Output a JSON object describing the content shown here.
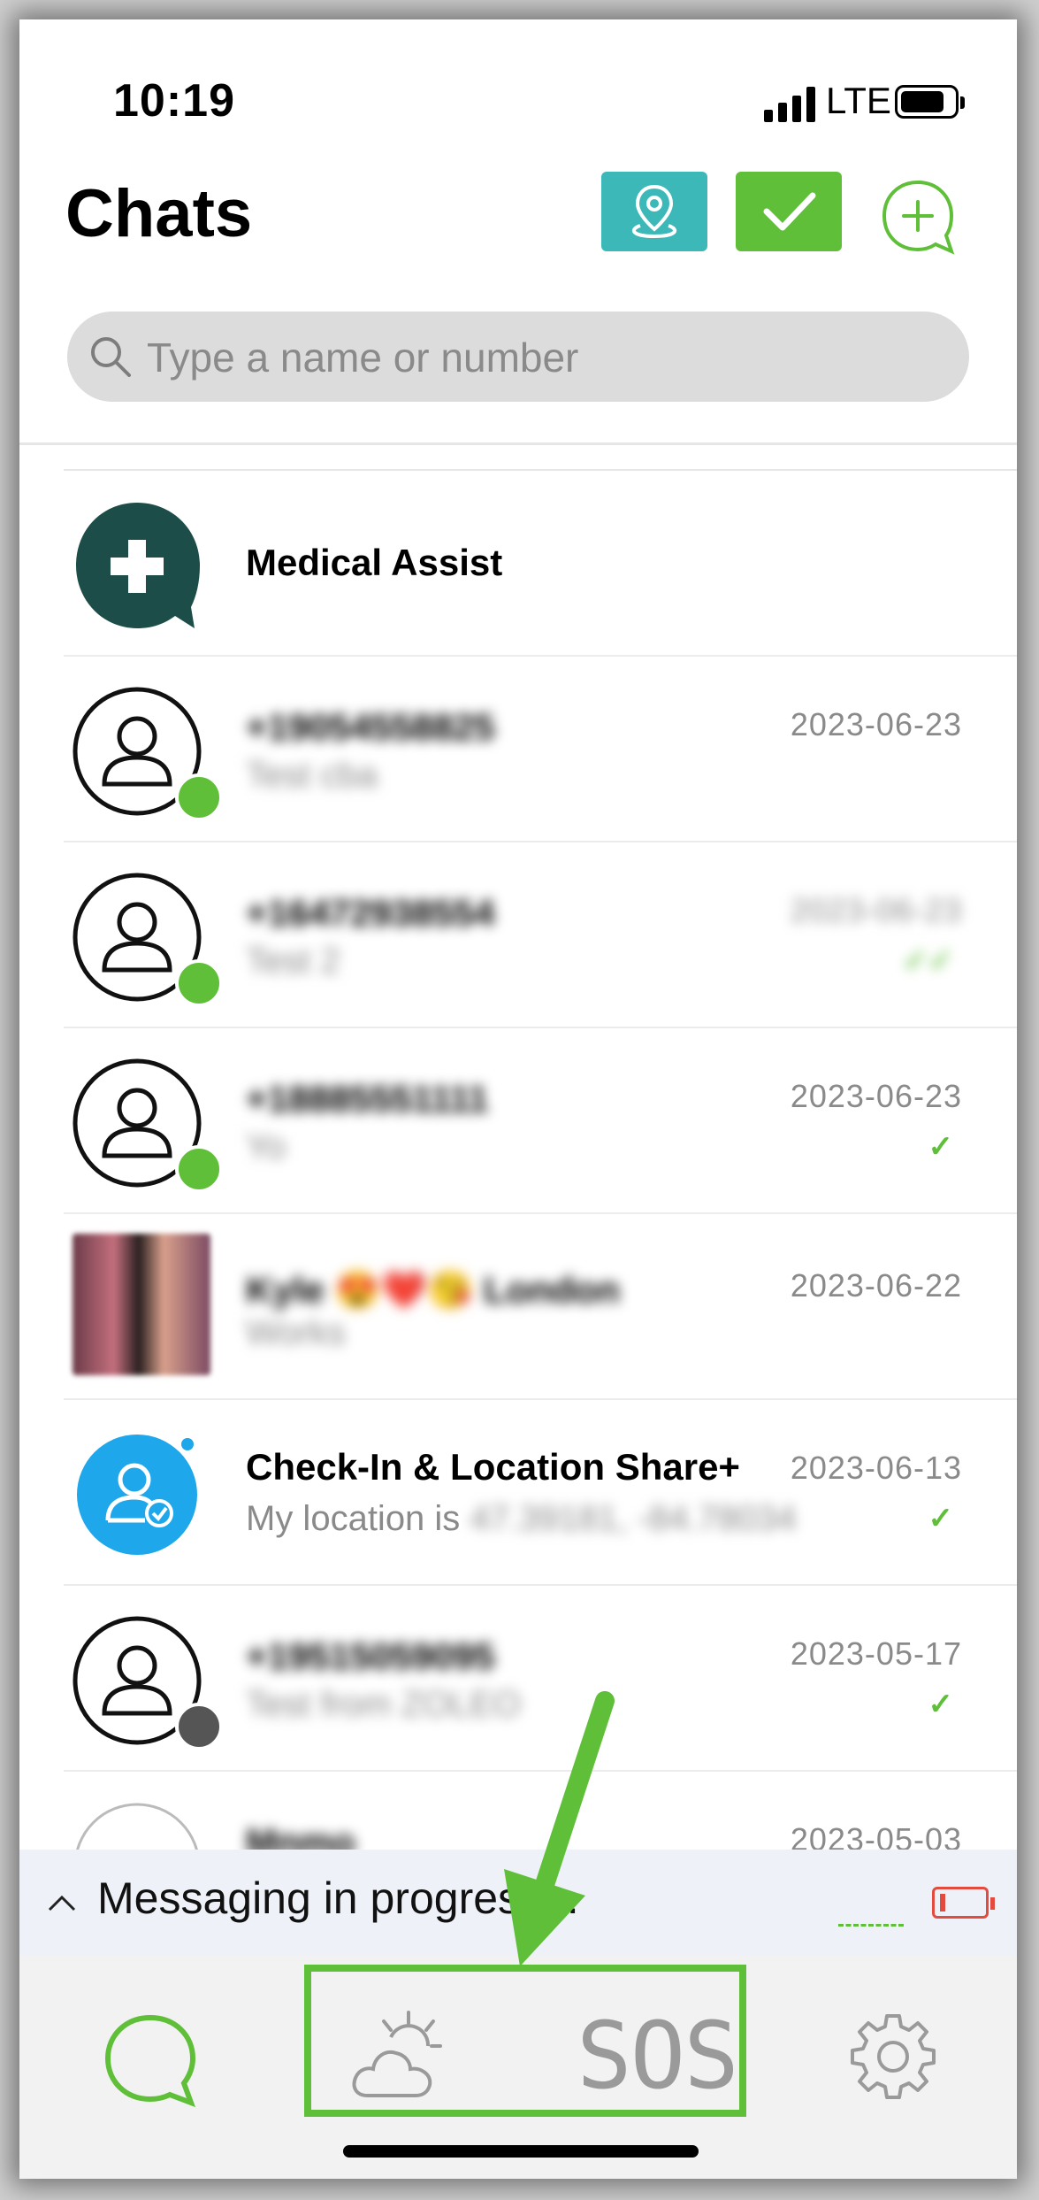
{
  "status_bar": {
    "time": "10:19",
    "network": "LTE"
  },
  "header": {
    "title": "Chats"
  },
  "search": {
    "placeholder": "Type a name or number"
  },
  "chats": [
    {
      "name": "Medical Assist",
      "preview": "",
      "date": "",
      "status": ""
    },
    {
      "name": "+19054558825",
      "preview": "Test cba",
      "date": "2023-06-23",
      "status": ""
    },
    {
      "name": "+16472938554",
      "preview": "Test 2",
      "date": "2023-06-23",
      "status": "read"
    },
    {
      "name": "+18885551111",
      "preview": "Yo",
      "date": "2023-06-23",
      "status": "sent"
    },
    {
      "name": "Kyle 😍❤️😘 London",
      "preview": "Works",
      "date": "2023-06-22",
      "status": ""
    },
    {
      "name": "Check-In & Location Share+",
      "preview_prefix": "My location is",
      "preview_blur": "47.39181, -84.78034",
      "date": "2023-06-13",
      "status": "sent"
    },
    {
      "name": "+19515059095",
      "preview": "Test from ZOLEO",
      "date": "2023-05-17",
      "status": "sent"
    },
    {
      "name": "Mnmo",
      "preview": "",
      "date": "2023-05-03",
      "status": ""
    }
  ],
  "messaging_bar": {
    "text": "Messaging in progress..."
  },
  "tabs": {
    "sos_label": "SOS"
  },
  "colors": {
    "accent_green": "#5fbf38",
    "teal": "#3cb8b8",
    "medical": "#1d4d48",
    "checkin_blue": "#1ea7ea",
    "battery_red": "#e34b3e"
  },
  "icons": [
    "map-pin-icon",
    "check-icon",
    "new-chat-icon",
    "search-icon",
    "medical-cross-icon",
    "contact-icon",
    "sync-badge-icon",
    "chevron-up-icon",
    "battery-low-icon",
    "chat-bubble-icon",
    "weather-icon",
    "settings-icon"
  ]
}
